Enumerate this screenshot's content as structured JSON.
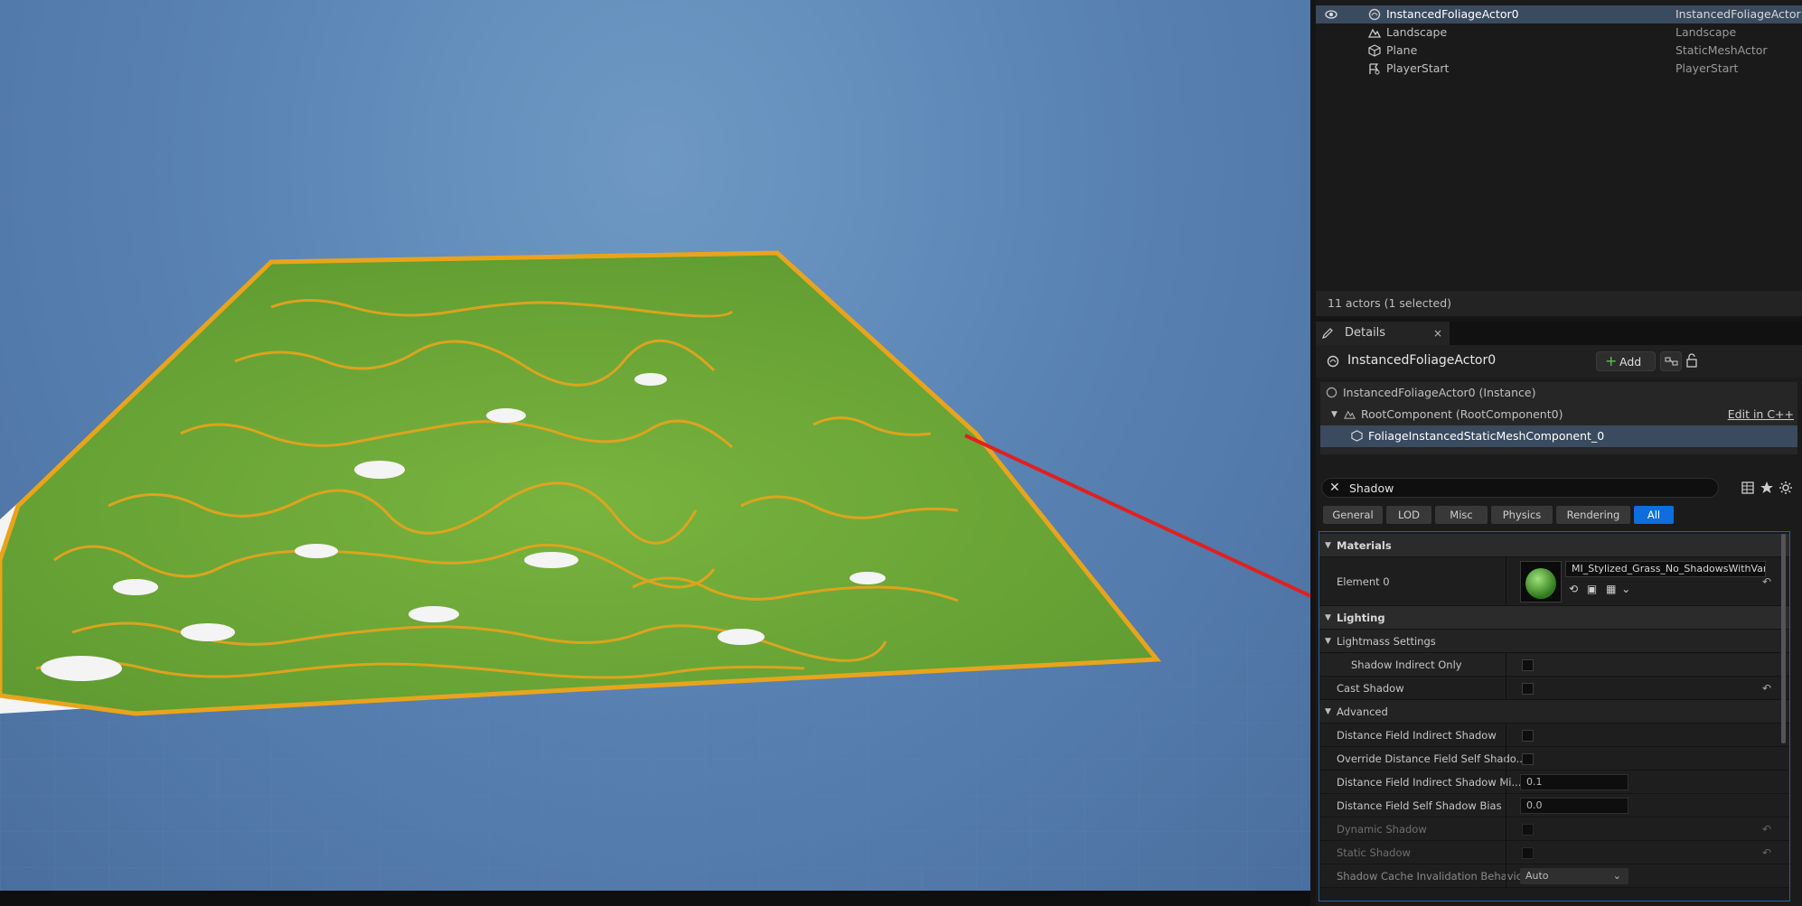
{
  "outliner": {
    "rows": [
      {
        "name": "InstancedFoliageActor0",
        "type": "InstancedFoliageActor",
        "icon": "foliage-actor-icon",
        "selected": true
      },
      {
        "name": "Landscape",
        "type": "Landscape",
        "icon": "landscape-icon",
        "selected": false
      },
      {
        "name": "Plane",
        "type": "StaticMeshActor",
        "icon": "static-mesh-icon",
        "selected": false
      },
      {
        "name": "PlayerStart",
        "type": "PlayerStart",
        "icon": "player-start-icon",
        "selected": false
      }
    ],
    "actors_count": "11 actors (1 selected)"
  },
  "details": {
    "tab_label": "Details",
    "close_glyph": "×",
    "actor_name": "InstancedFoliageActor0",
    "add_label": "Add",
    "add_glyph": "+",
    "components": {
      "instance": "InstancedFoliageActor0 (Instance)",
      "root": "RootComponent (RootComponent0)",
      "edit_cpp": "Edit in C++",
      "mesh": "FoliageInstancedStaticMeshComponent_0"
    },
    "search": {
      "value": "Shadow",
      "clear_glyph": "✕"
    },
    "categories": [
      "General",
      "LOD",
      "Misc",
      "Physics",
      "Rendering",
      "All"
    ],
    "active_category": "All",
    "properties": {
      "materials_section": "Materials",
      "element0_label": "Element 0",
      "element0_material": "MI_Stylized_Grass_No_ShadowsWithVariation",
      "lighting_section": "Lighting",
      "lightmass_section": "Lightmass Settings",
      "shadow_indirect_only": "Shadow Indirect Only",
      "cast_shadow": "Cast Shadow",
      "advanced_section": "Advanced",
      "df_indirect_shadow": "Distance Field Indirect Shadow",
      "override_df_self_shadow": "Override Distance Field Self Shado...",
      "df_indirect_shadow_min": "Distance Field Indirect Shadow Mi...",
      "df_indirect_shadow_min_value": "0.1",
      "df_self_shadow_bias": "Distance Field Self Shadow Bias",
      "df_self_shadow_bias_value": "0.0",
      "dynamic_shadow": "Dynamic Shadow",
      "static_shadow": "Static Shadow",
      "shadow_cache_invalidation": "Shadow Cache Invalidation Behavior",
      "shadow_cache_invalidation_value": "Auto"
    },
    "reset_glyph": "↶"
  },
  "colors": {
    "selection": "#3a4a5f",
    "accent_blue": "#0e6edb",
    "grass_green": "#6fad3a",
    "foliage_orange": "#e8a41c",
    "arrow_red": "#e02020"
  }
}
